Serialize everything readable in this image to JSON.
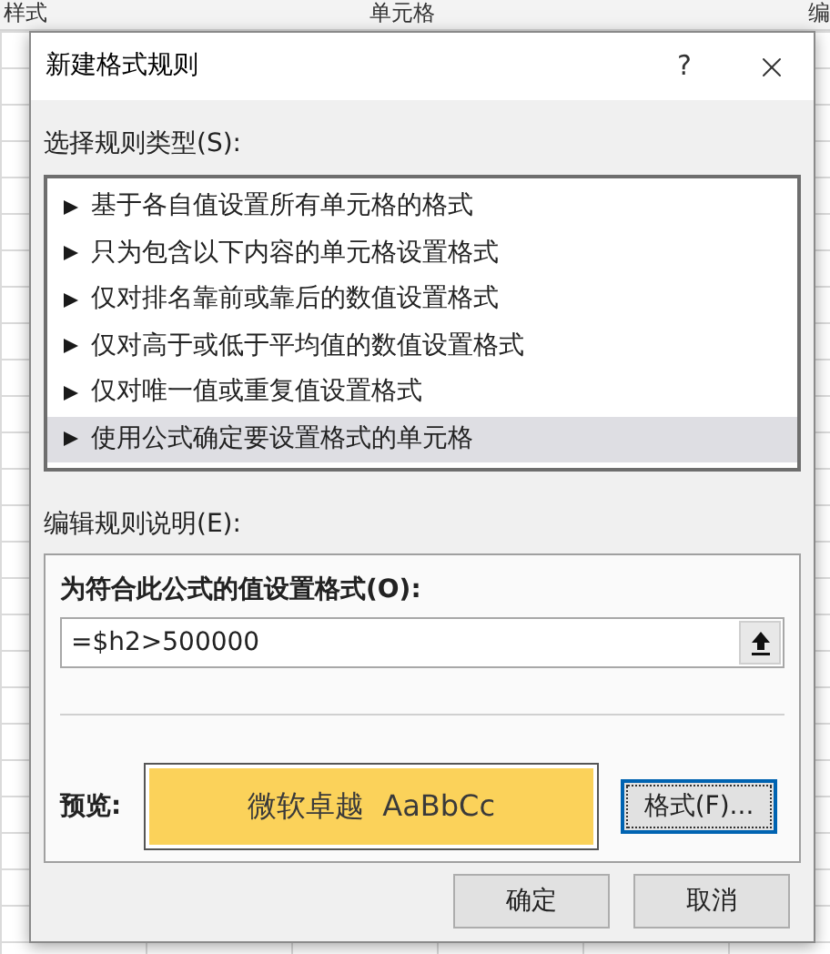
{
  "sheet": {
    "headers": [
      "样式",
      "单元格",
      "编"
    ]
  },
  "dialog": {
    "title": "新建格式规则",
    "help_button": "?",
    "rule_type_label": "选择规则类型(S):",
    "rule_types": [
      {
        "label": "基于各自值设置所有单元格的格式",
        "selected": false
      },
      {
        "label": "只为包含以下内容的单元格设置格式",
        "selected": false
      },
      {
        "label": "仅对排名靠前或靠后的数值设置格式",
        "selected": false
      },
      {
        "label": "仅对高于或低于平均值的数值设置格式",
        "selected": false
      },
      {
        "label": "仅对唯一值或重复值设置格式",
        "selected": false
      },
      {
        "label": "使用公式确定要设置格式的单元格",
        "selected": true
      }
    ],
    "description_label": "编辑规则说明(E):",
    "formula_label": "为符合此公式的值设置格式(O):",
    "formula": {
      "value": "=$h2>500000"
    },
    "preview_label": "预览:",
    "preview_text": "微软卓越  AaBbCc",
    "format_button": "格式(F)...",
    "buttons": [
      "确定",
      "取消"
    ]
  }
}
